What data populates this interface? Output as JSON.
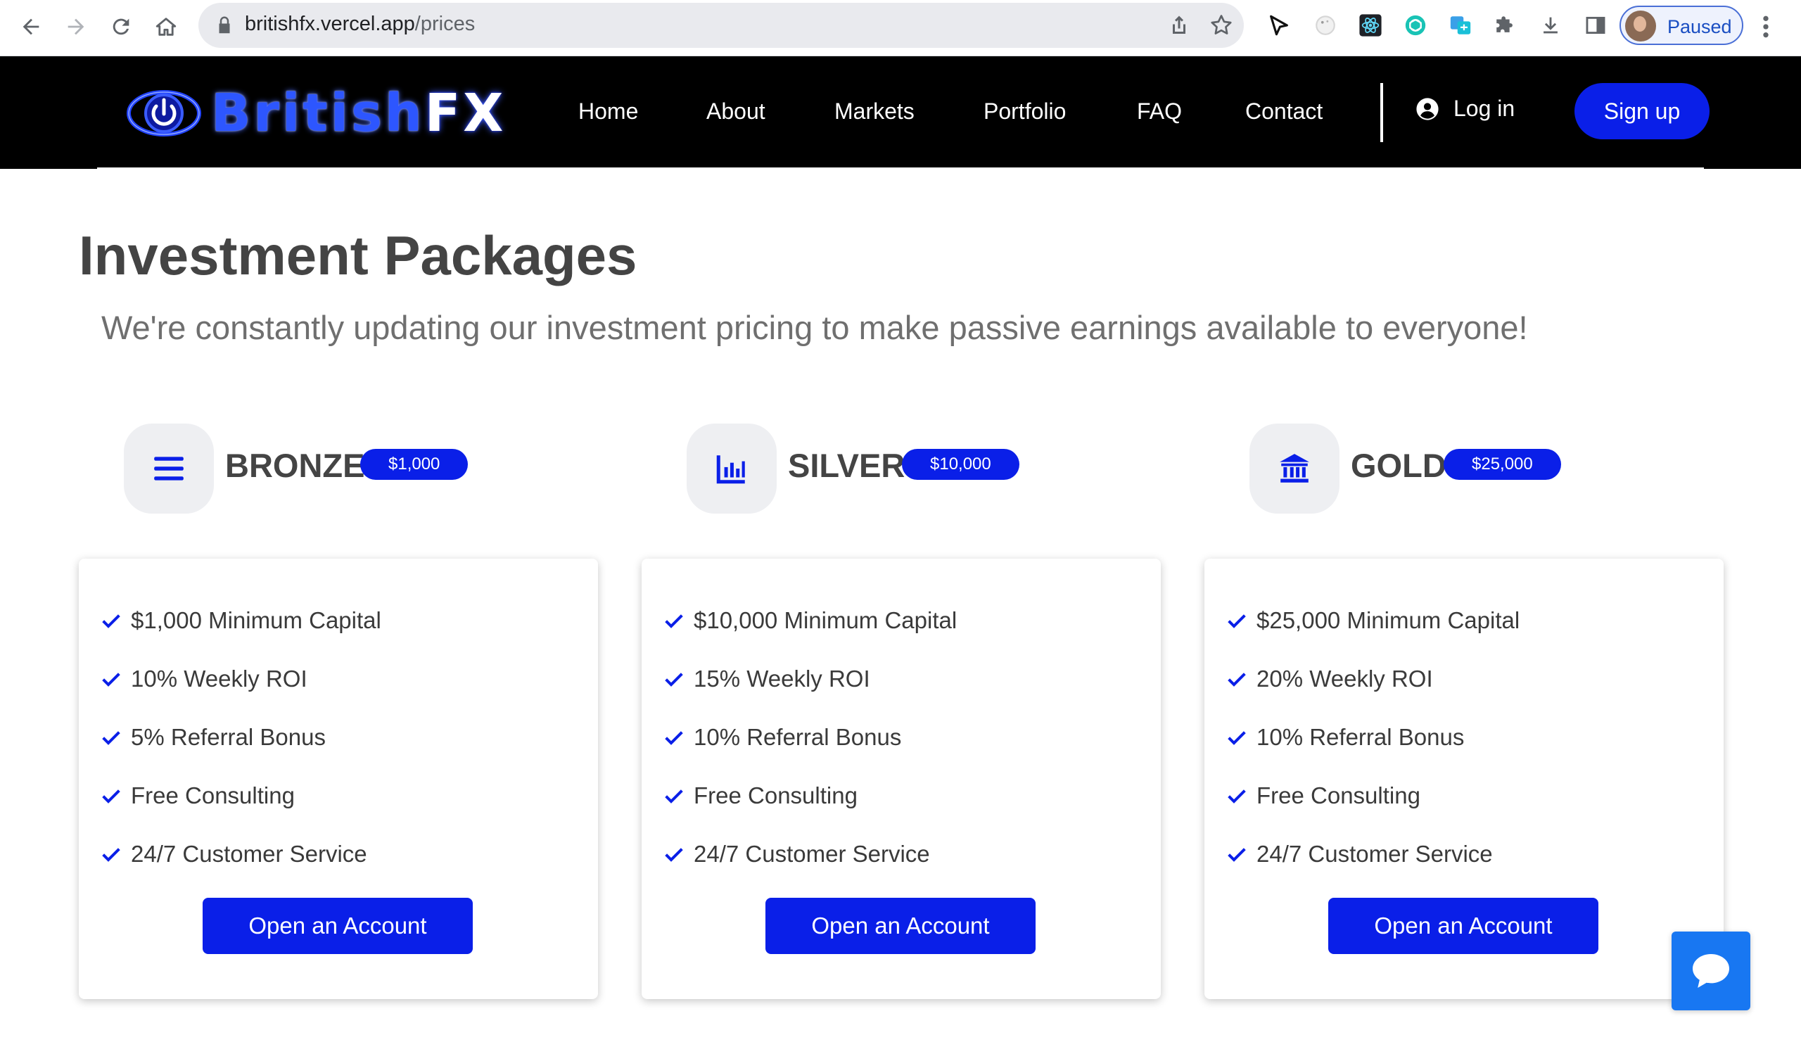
{
  "browser": {
    "url_host": "britishfx.vercel.app",
    "url_path": "/prices",
    "profile_label": "Paused"
  },
  "header": {
    "logo_text_main": "British",
    "logo_text_accent": "FX",
    "nav": [
      "Home",
      "About",
      "Markets",
      "Portfolio",
      "FAQ",
      "Contact"
    ],
    "login_label": "Log in",
    "signup_label": "Sign up"
  },
  "page": {
    "title": "Investment Packages",
    "subtitle": "We're constantly updating our investment pricing to make passive earnings available to everyone!"
  },
  "packages": [
    {
      "name": "BRONZE",
      "price": "$1,000",
      "icon": "bars-icon",
      "features": [
        "$1,000 Minimum Capital",
        "10% Weekly ROI",
        "5% Referral Bonus",
        "Free Consulting",
        "24/7 Customer Service"
      ],
      "button_label": "Open an Account"
    },
    {
      "name": "SILVER",
      "price": "$10,000",
      "icon": "chart-icon",
      "features": [
        "$10,000 Minimum Capital",
        "15% Weekly ROI",
        "10% Referral Bonus",
        "Free Consulting",
        "24/7 Customer Service"
      ],
      "button_label": "Open an Account"
    },
    {
      "name": "GOLD",
      "price": "$25,000",
      "icon": "bank-icon",
      "features": [
        "$25,000 Minimum Capital",
        "20% Weekly ROI",
        "10% Referral Bonus",
        "Free Consulting",
        "24/7 Customer Service"
      ],
      "button_label": "Open an Account"
    }
  ],
  "colors": {
    "brand_blue": "#0a1fe8",
    "header_bg": "#000000",
    "chat_blue": "#1877f2"
  }
}
